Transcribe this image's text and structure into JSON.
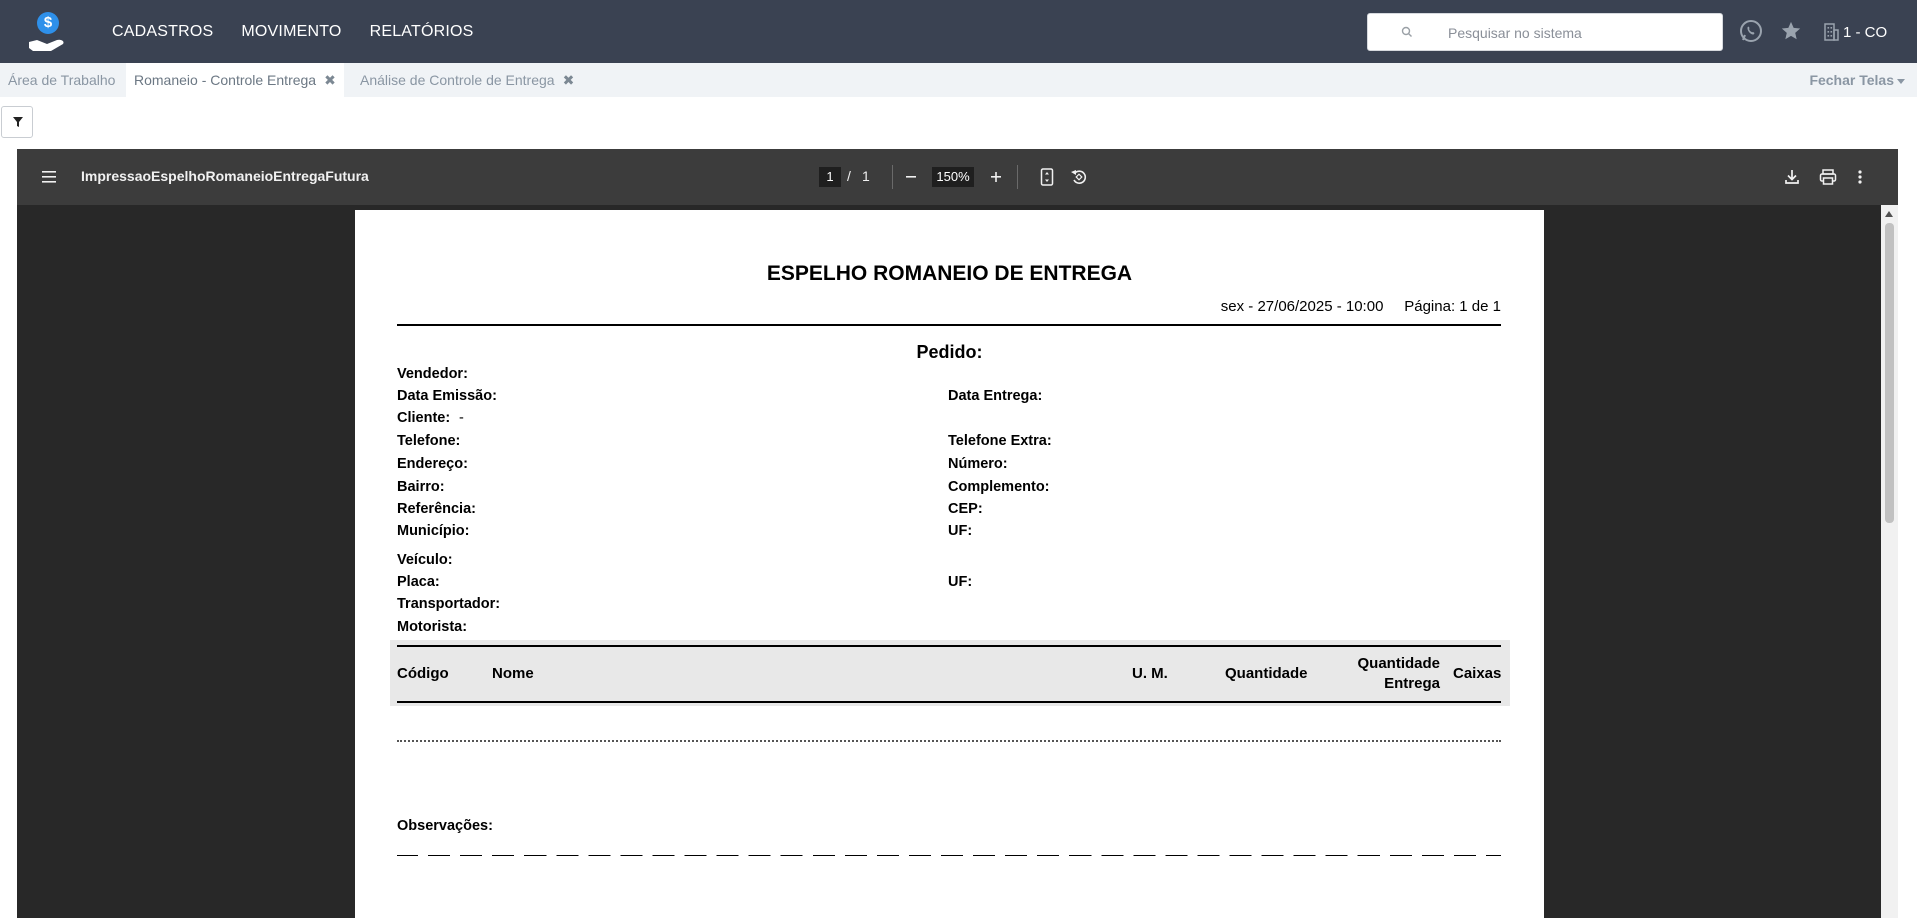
{
  "navbar": {
    "menu": [
      "CADASTROS",
      "MOVIMENTO",
      "RELATÓRIOS"
    ],
    "search_placeholder": "Pesquisar no sistema",
    "org_label": "1 - CO",
    "logo_symbol": "$",
    "icons": [
      "logo-icon",
      "search-icon",
      "whatsapp-icon",
      "star-icon",
      "building-icon"
    ]
  },
  "tabs": {
    "items": [
      {
        "label": "Área de Trabalho",
        "closable": false
      },
      {
        "label": "Romaneio - Controle Entrega",
        "closable": true,
        "active": true
      },
      {
        "label": "Análise de Controle de Entrega",
        "closable": true
      }
    ],
    "close_all": "Fechar Telas",
    "close_symbol": "✖"
  },
  "pdf": {
    "title": "ImpressaoEspelhoRomaneioEntregaFutura",
    "current_page": "1",
    "page_sep": "/",
    "total_pages": "1",
    "zoom": "150%",
    "colors": {
      "toolbar": "#3c3c3c",
      "background": "#282828"
    }
  },
  "document": {
    "title": "ESPELHO ROMANEIO DE ENTREGA",
    "date_line": "sex - 27/06/2025 - 10:00     Página: 1 de 1",
    "pedido": "Pedido:",
    "fields_left": {
      "vendedor": "Vendedor:",
      "data_emissao": "Data Emissão:",
      "cliente": "Cliente:",
      "telefone": "Telefone:",
      "endereco": "Endereço:",
      "bairro": "Bairro:",
      "referencia": "Referência:",
      "municipio": "Município:",
      "veiculo": "Veículo:",
      "placa": "Placa:",
      "transportador": "Transportador:",
      "motorista": "Motorista:"
    },
    "cliente_value": "-",
    "fields_right": {
      "data_entrega": "Data Entrega:",
      "telefone_extra": "Telefone Extra:",
      "numero": "Número:",
      "complemento": "Complemento:",
      "cep": "CEP:",
      "uf": "UF:",
      "uf_placa": "UF:"
    },
    "table_headers": {
      "codigo": "Código",
      "nome": "Nome",
      "um": "U. M.",
      "quantidade": "Quantidade",
      "quantidade_entrega_1": "Quantidade",
      "quantidade_entrega_2": "Entrega",
      "caixas": "Caixas"
    },
    "observacoes": "Observações:"
  }
}
